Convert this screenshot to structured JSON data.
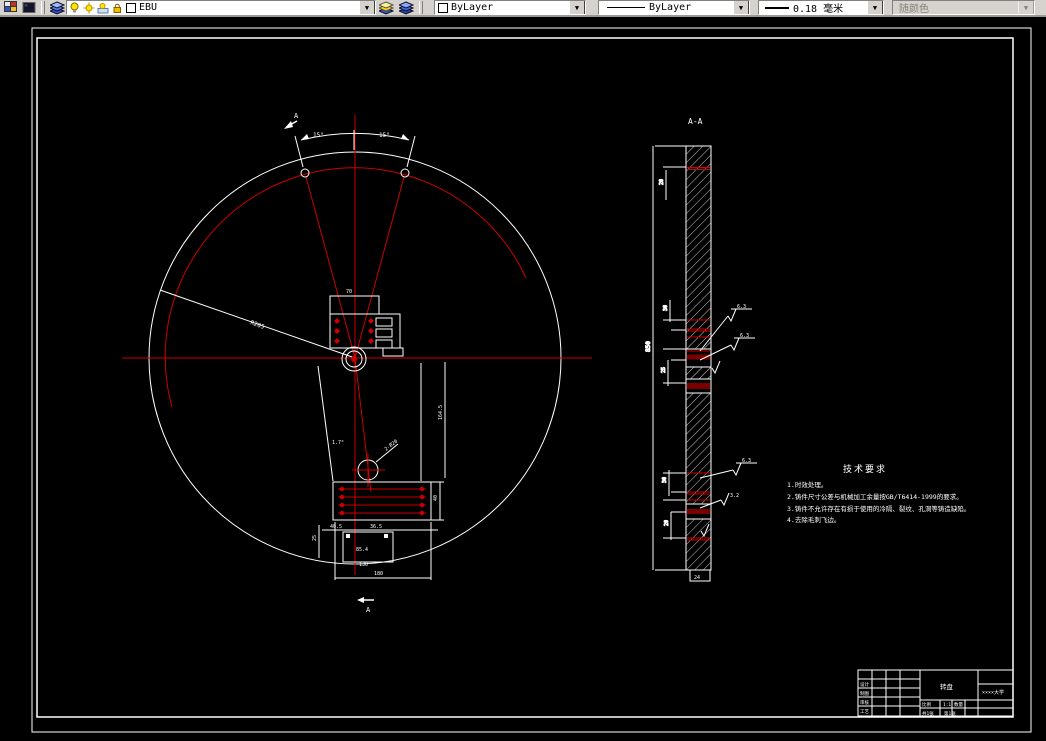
{
  "toolbar": {
    "layer_combo": {
      "value": "EBU"
    },
    "color_combo": {
      "value": "ByLayer"
    },
    "linetype_combo": {
      "value": "ByLayer"
    },
    "lineweight_combo": {
      "value": "0.18 毫米"
    },
    "plotstyle_combo": {
      "value": "随颜色"
    }
  },
  "drawing": {
    "section": {
      "title": "A-A",
      "marker": "A"
    },
    "dims": {
      "angle_left": "15°",
      "angle_right": "15°",
      "hub_width": "70",
      "radius": "R205",
      "lower_angle": "1.7°",
      "hole_note": "2-Ø20",
      "plate_height": "40",
      "col_height": "164.5",
      "chain_a": "40.5",
      "chain_b": "36.5",
      "inner_width": "85.4",
      "mid_width": "130",
      "total_width": "180",
      "left_col": "25",
      "sec_total": "850",
      "sec_d1": "20",
      "sec_d2": "30",
      "sec_d3": "25",
      "sec_d4": "30",
      "sec_d5": "20",
      "foot": "24",
      "rough_a": "6.3",
      "rough_b": "6.3",
      "rough_c": "6.3",
      "rough_d": "3.2"
    },
    "tech_req": {
      "title": "技术要求",
      "items": [
        "1.时效处理。",
        "2.铸件尺寸公差与机械加工余量按GB/T6414-1999的要求。",
        "3.铸件不允许存在有损于使用的冷隔、裂纹、孔洞等铸造缺陷。",
        "4.去除毛刺飞边。"
      ]
    },
    "title_block": {
      "part_name": "转盘",
      "org": "××××大学",
      "design": "设计",
      "draft": "制图",
      "review": "审核",
      "process": "工艺",
      "scale_label": "比例",
      "scale_value": "1:1",
      "qty_label": "数量",
      "sheet": "共1张",
      "page": "第1张"
    }
  },
  "colors": {
    "red": "#cc0000",
    "maroon": "#7a0000",
    "white": "#ffffff",
    "toolbar_bg": "#d6d3ce"
  }
}
